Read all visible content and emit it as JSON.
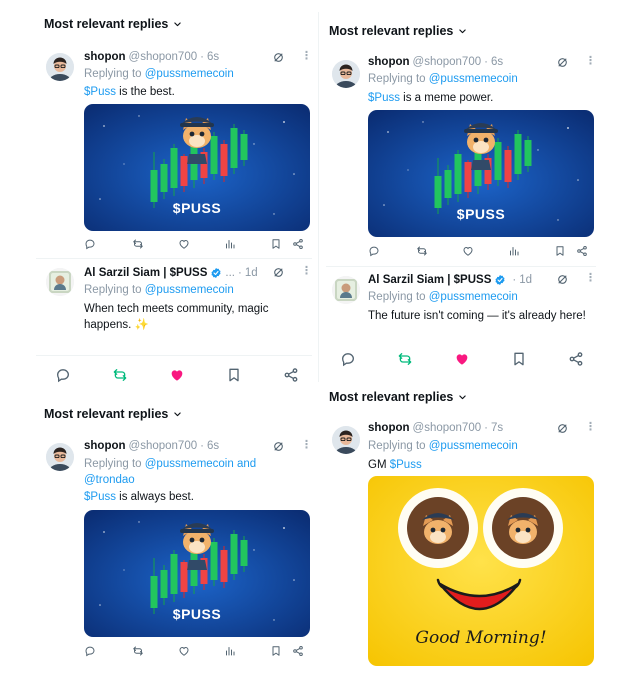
{
  "colors": {
    "link": "#1d9bf0",
    "muted": "#8b98a5",
    "text": "#0f1419",
    "like": "#f91880",
    "repost": "#00ba7c"
  },
  "sections": {
    "top_left": "Most relevant replies",
    "top_right": "Most relevant replies",
    "mid_left": "Most relevant replies",
    "mid_right": "Most relevant replies"
  },
  "tweets": {
    "t1": {
      "name": "shopon",
      "handle": "@shopon700",
      "dot": "·",
      "time": "6s",
      "replying": "Replying to",
      "mention": "@pussmemecoin",
      "cashtag": "$Puss",
      "text": " is the best.",
      "media_label": "$PUSS"
    },
    "t2": {
      "name": "Al Sarzil Siam | $PUSS",
      "handle": "...",
      "dot": "·",
      "time": "1d",
      "replying": "Replying to",
      "mention": "@pussmemecoin",
      "text": "When tech meets community, magic happens. ✨"
    },
    "t3": {
      "name": "shopon",
      "handle": "@shopon700",
      "dot": "·",
      "time": "6s",
      "replying": "Replying to",
      "mention": "@pussmemecoin",
      "mention_and": "and",
      "mention2": "@trondao",
      "cashtag": "$Puss",
      "text": " is always best.",
      "media_label": "$PUSS"
    },
    "t4": {
      "name": "shopon",
      "handle": "@shopon700",
      "dot": "·",
      "time": "6s",
      "replying": "Replying to",
      "mention": "@pussmemecoin",
      "cashtag": "$Puss",
      "text": " is a meme power.",
      "media_label": "$PUSS"
    },
    "t5": {
      "name": "Al Sarzil Siam | $PUSS",
      "handle": "",
      "dot": "·",
      "time": "1d",
      "replying": "Replying to",
      "mention": "@pussmemecoin",
      "text": "The future isn't coming — it's already here!"
    },
    "t6": {
      "name": "shopon",
      "handle": "@shopon700",
      "dot": "·",
      "time": "7s",
      "replying": "Replying to",
      "mention": "@pussmemecoin",
      "text_prefix": "GM ",
      "cashtag": "$Puss",
      "media_text": "Good Morning!"
    }
  },
  "icons": {
    "reply": "reply-icon",
    "repost": "repost-icon",
    "like": "like-icon",
    "views": "views-icon",
    "bookmark": "bookmark-icon",
    "share": "share-icon",
    "grok": "grok-icon",
    "more": "more-icon",
    "verified": "verified-badge-icon",
    "sparkle": "sparkle-icon"
  }
}
